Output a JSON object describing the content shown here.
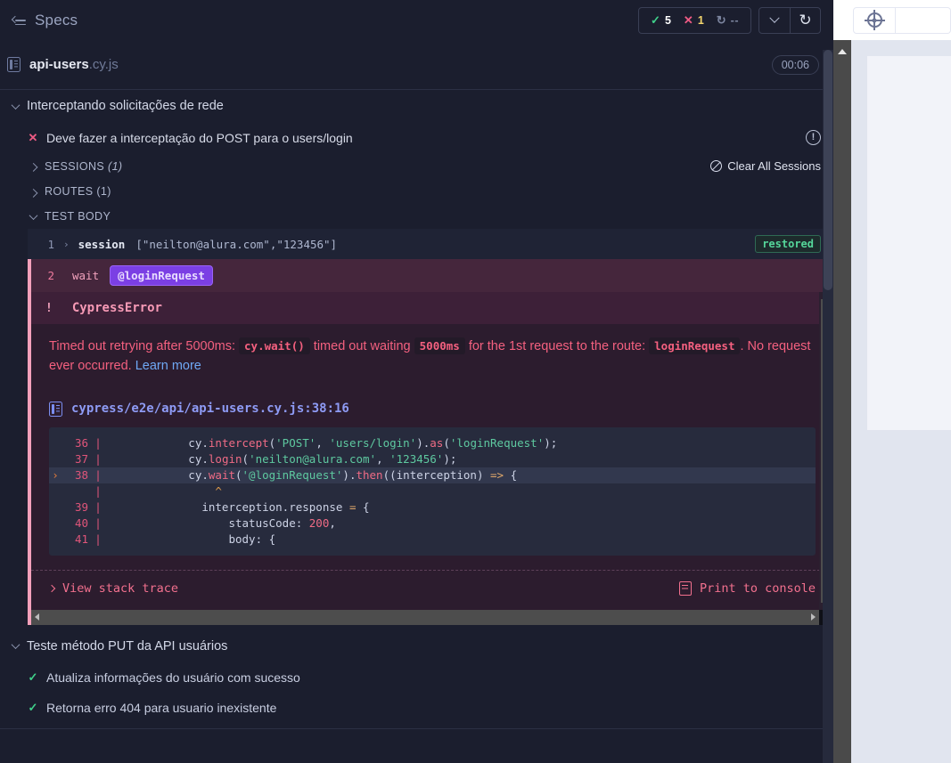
{
  "header": {
    "specs_label": "Specs",
    "collapse_icon": "collapse-sidebar-icon",
    "stats": {
      "passed_glyph": "✓",
      "passed_count": "5",
      "failed_glyph": "✕",
      "failed_count": "1",
      "pending_glyph": "↻",
      "pending_count": "--"
    },
    "chevron_icon": "chevron-down-icon",
    "reload_icon": "↻"
  },
  "spec": {
    "file_icon": "file-icon",
    "name": "api-users",
    "extension": ".cy.js",
    "timer": "00:06"
  },
  "suite": {
    "title": "Interceptando solicitações de rede",
    "test": {
      "mark": "✕",
      "title": "Deve fazer a interceptação do POST para o users/login",
      "warning_icon": "alert-circle-icon"
    },
    "sessions": {
      "label": "SESSIONS",
      "count": "(1)",
      "clear_label": "Clear All Sessions",
      "clear_icon": "ban-icon"
    },
    "routes": {
      "label": "ROUTES (1)"
    },
    "test_body_label": "TEST BODY"
  },
  "commands": [
    {
      "number": "1",
      "expander": "›",
      "name": "session",
      "args": "[\"neilton@alura.com\",\"123456\"]",
      "badge": "restored"
    },
    {
      "number": "2",
      "name": "wait",
      "alias": "@loginRequest"
    }
  ],
  "error": {
    "bang": "!",
    "name": "CypressError",
    "message_part_1": "Timed out retrying after 5000ms:",
    "chip_1": "cy.wait()",
    "message_part_2": "timed out waiting",
    "chip_2": "5000ms",
    "message_part_3": "for the 1st request to the route:",
    "chip_3": "loginRequest",
    "message_part_4": ".",
    "message_part_5": "No request ever occurred.",
    "learn_more": "Learn more",
    "codeframe": {
      "file_icon": "file-icon",
      "path": "cypress/e2e/api/api-users.cy.js:38:16",
      "lines": [
        {
          "number": "36",
          "arrow": "",
          "highlight": false,
          "tokens": [
            {
              "t": "            cy.",
              "c": "plain"
            },
            {
              "t": "intercept",
              "c": "fn"
            },
            {
              "t": "(",
              "c": "plain"
            },
            {
              "t": "'POST'",
              "c": "str"
            },
            {
              "t": ", ",
              "c": "plain"
            },
            {
              "t": "'users/login'",
              "c": "str"
            },
            {
              "t": ").",
              "c": "plain"
            },
            {
              "t": "as",
              "c": "fn"
            },
            {
              "t": "(",
              "c": "plain"
            },
            {
              "t": "'loginRequest'",
              "c": "str"
            },
            {
              "t": ");",
              "c": "plain"
            }
          ]
        },
        {
          "number": "37",
          "arrow": "",
          "highlight": false,
          "tokens": [
            {
              "t": "            cy.",
              "c": "plain"
            },
            {
              "t": "login",
              "c": "fn"
            },
            {
              "t": "(",
              "c": "plain"
            },
            {
              "t": "'neilton@alura.com'",
              "c": "str"
            },
            {
              "t": ", ",
              "c": "plain"
            },
            {
              "t": "'123456'",
              "c": "str"
            },
            {
              "t": ");",
              "c": "plain"
            }
          ]
        },
        {
          "number": "38",
          "arrow": "›",
          "highlight": true,
          "tokens": [
            {
              "t": "            cy.",
              "c": "plain"
            },
            {
              "t": "wait",
              "c": "fn"
            },
            {
              "t": "(",
              "c": "plain"
            },
            {
              "t": "'@loginRequest'",
              "c": "str"
            },
            {
              "t": ").",
              "c": "plain"
            },
            {
              "t": "then",
              "c": "fn"
            },
            {
              "t": "((interception) ",
              "c": "plain"
            },
            {
              "t": "=>",
              "c": "op"
            },
            {
              "t": " {",
              "c": "plain"
            }
          ]
        },
        {
          "number": "",
          "arrow": "",
          "highlight": false,
          "tokens": [
            {
              "t": "                ^",
              "c": "caret"
            }
          ]
        },
        {
          "number": "39",
          "arrow": "",
          "highlight": false,
          "tokens": [
            {
              "t": "              interception.response ",
              "c": "plain"
            },
            {
              "t": "=",
              "c": "op"
            },
            {
              "t": " {",
              "c": "plain"
            }
          ]
        },
        {
          "number": "40",
          "arrow": "",
          "highlight": false,
          "tokens": [
            {
              "t": "                  statusCode: ",
              "c": "plain"
            },
            {
              "t": "200",
              "c": "num"
            },
            {
              "t": ",",
              "c": "plain"
            }
          ]
        },
        {
          "number": "41",
          "arrow": "",
          "highlight": false,
          "tokens": [
            {
              "t": "                  body: {",
              "c": "plain"
            }
          ]
        }
      ]
    },
    "stack_trace_label": "View stack trace",
    "print_console_label": "Print to console",
    "print_console_icon": "print-icon"
  },
  "suite2": {
    "title": "Teste método PUT da API usuários",
    "tests": [
      {
        "mark": "✓",
        "title": "Atualiza informações do usuário com sucesso"
      },
      {
        "mark": "✓",
        "title": "Retorna erro 404 para usuario inexistente"
      }
    ]
  },
  "aut": {
    "selector_icon": "selector-playground-icon",
    "url_value": "",
    "url_placeholder": ""
  },
  "colors": {
    "bg": "#1b1e2e",
    "pass": "#3fd08a",
    "fail": "#ef5b84",
    "alias": "#7b3fe4",
    "error_bg": "#2c1c2e",
    "link": "#6fa8f5"
  }
}
